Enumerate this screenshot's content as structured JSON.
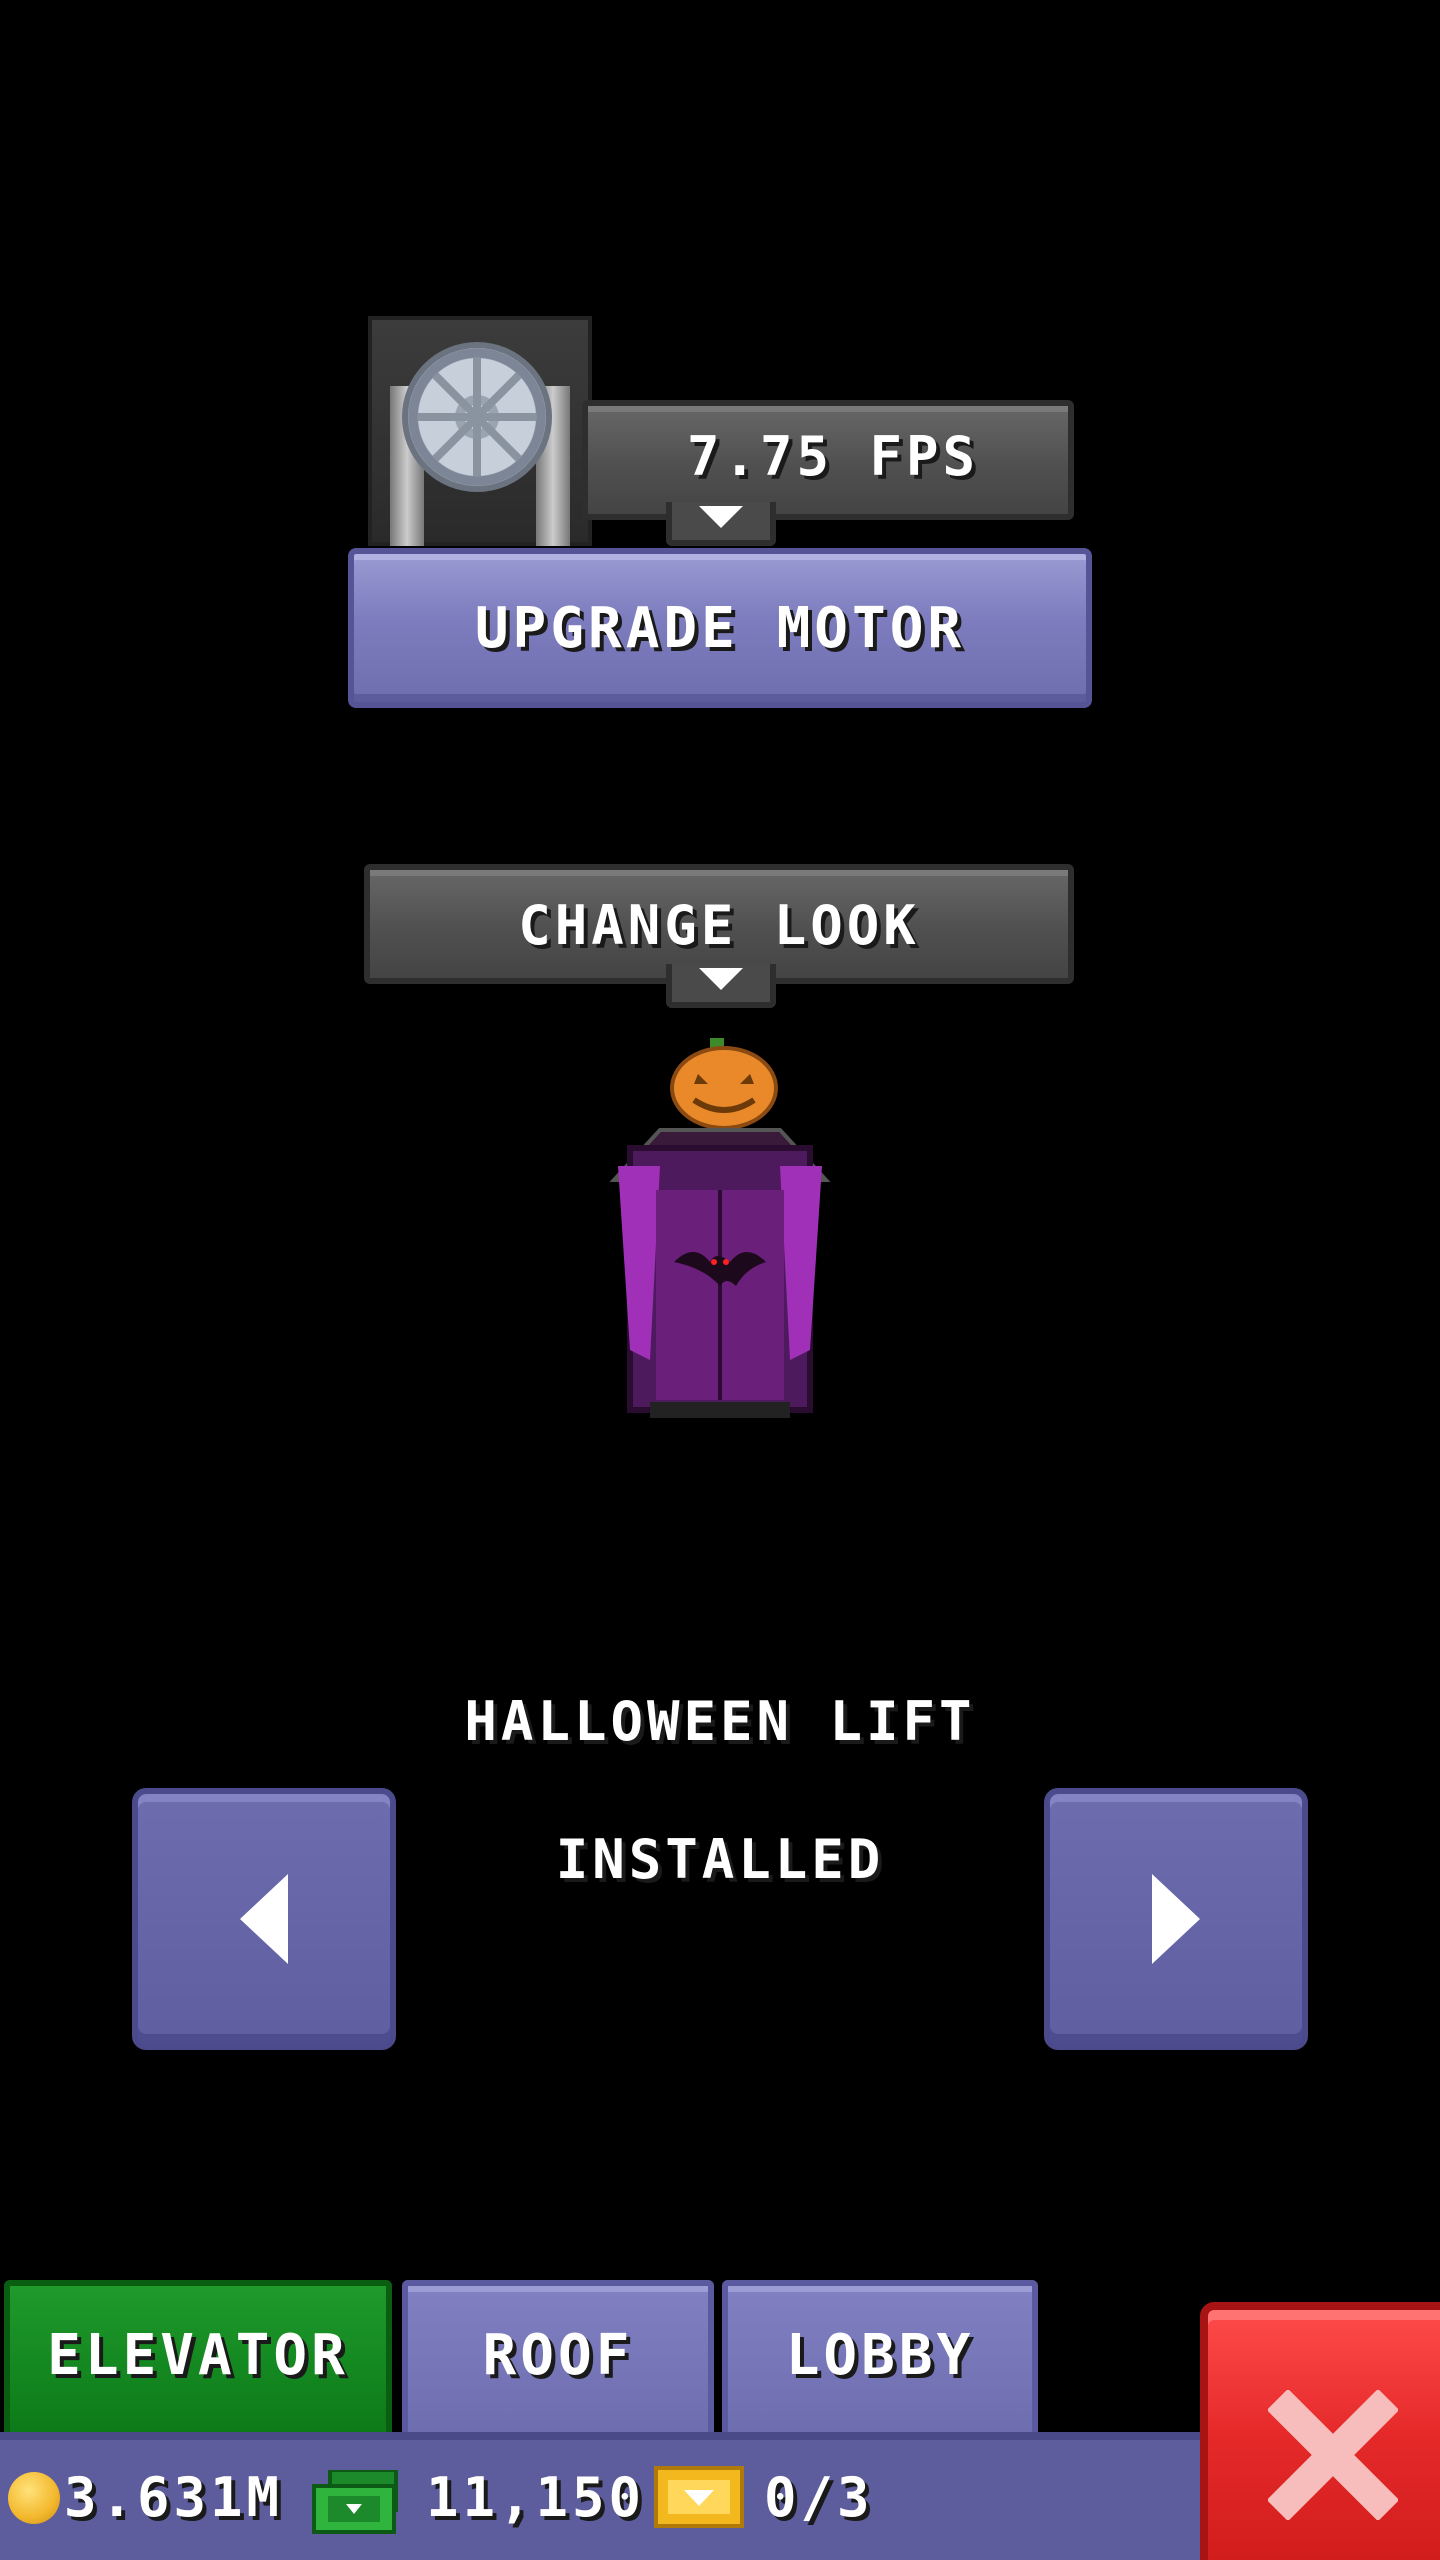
{
  "motor": {
    "speed_label": "7.75 FPS",
    "upgrade_label": "UPGRADE MOTOR"
  },
  "look": {
    "change_label": "CHANGE LOOK",
    "lift_name": "HALLOWEEN LIFT",
    "status": "INSTALLED"
  },
  "tabs": [
    {
      "label": "ELEVATOR",
      "active": true
    },
    {
      "label": "ROOF",
      "active": false
    },
    {
      "label": "LOBBY",
      "active": false
    }
  ],
  "status_bar": {
    "coins": "3.631M",
    "bux": "11,150",
    "tickets": "0/3"
  },
  "icons": {
    "coin": "coin-icon",
    "bux": "bux-icon",
    "ticket": "ticket-icon",
    "close": "close-icon"
  },
  "colors": {
    "active_tab": "#0c7a18",
    "button_purple": "#7c7cbe",
    "close_red": "#e52929"
  }
}
